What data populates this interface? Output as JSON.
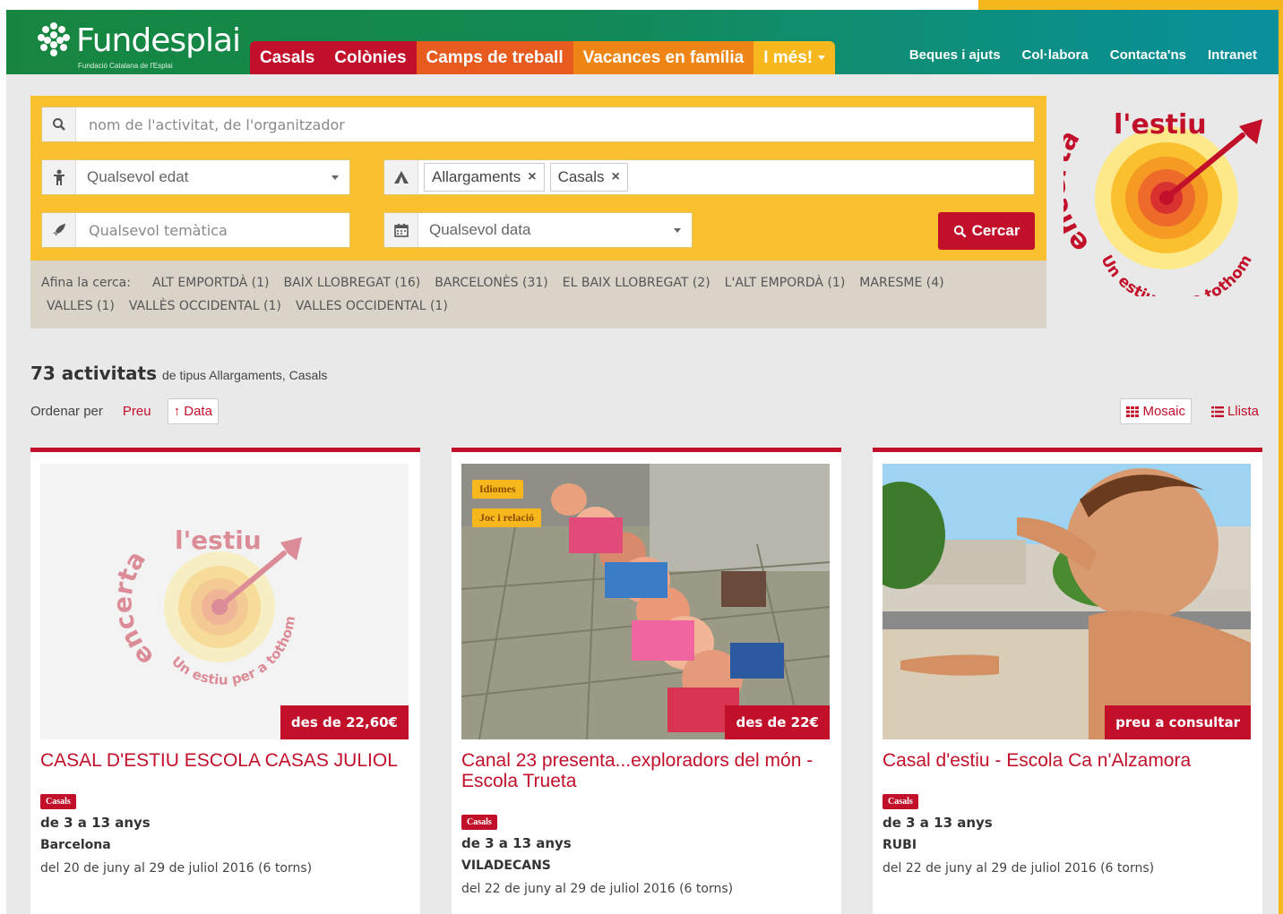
{
  "header": {
    "brand": "Fundesplai",
    "tagline": "Fundació Catalana de l'Esplai",
    "nav": [
      {
        "label": "Casals"
      },
      {
        "label": "Colònies"
      },
      {
        "label": "Camps de treball"
      },
      {
        "label": "Vacances en família"
      },
      {
        "label": "I més!"
      }
    ],
    "util": [
      "Beques i ajuts",
      "Col·labora",
      "Contacta'ns",
      "Intranet"
    ]
  },
  "search": {
    "placeholder": "nom de l'activitat, de l'organitzador",
    "age": "Qualsevol edat",
    "tags": [
      "Allargaments",
      "Casals"
    ],
    "theme_placeholder": "Qualsevol temàtica",
    "date": "Qualsevol data",
    "button": "Cercar"
  },
  "refine": {
    "label": "Afina la cerca:",
    "chips": [
      "ALT EMPORTDÀ (1)",
      "BAIX LLOBREGAT (16)",
      "BARCELONÈS (31)",
      "EL BAIX LLOBREGAT (2)",
      "L'ALT EMPORDÀ (1)",
      "MARESME (4)",
      "VALLES (1)",
      "VALLÈS OCCIDENTAL (1)",
      "VALLES OCCIDENTAL (1)"
    ]
  },
  "summer_logo": {
    "word1": "encerta",
    "word2": "l'estiu",
    "slogan": "Un estiu per a tothom"
  },
  "results": {
    "count": "73 activitats",
    "kind": "de tipus Allargaments, Casals"
  },
  "sort": {
    "label": "Ordenar per",
    "price": "Preu",
    "date": "Data",
    "date_arrow": "↑"
  },
  "view": {
    "mosaic": "Mosaic",
    "list": "Llista"
  },
  "cards": [
    {
      "title": "CASAL D'ESTIU ESCOLA CASAS JULIOL",
      "price": "des de 22,60€",
      "badge": "Casals",
      "ages": "de 3 a 13 anys",
      "place": "Barcelona",
      "dates": "del 20 de juny al 29 de juliol 2016 (6 torns)"
    },
    {
      "title": "Canal 23 presenta...exploradors del món - Escola Trueta",
      "price": "des de 22€",
      "badge": "Casals",
      "img_tags": [
        "Idiomes",
        "Joc i relació"
      ],
      "ages": "de 3 a 13 anys",
      "place": "VILADECANS",
      "dates": "del 22 de juny al 29 de juliol 2016 (6 torns)"
    },
    {
      "title": "Casal d'estiu - Escola Ca n'Alzamora",
      "price": "preu a consultar",
      "badge": "Casals",
      "ages": "de 3 a 13 anys",
      "place": "RUBI",
      "dates": "del 22 de juny al 29 de juliol 2016 (6 torns)"
    }
  ],
  "colors": {
    "accent": "#c2102a",
    "yellow": "#fbc02d",
    "header_green": "#16863f"
  }
}
